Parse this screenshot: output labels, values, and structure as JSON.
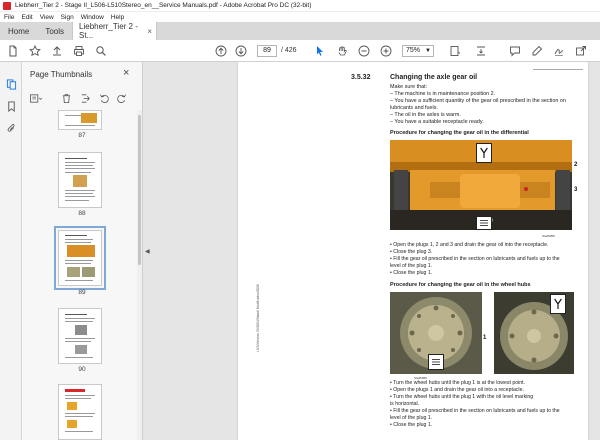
{
  "window": {
    "title": "Liebherr_Tier 2 - Stage II_L506-L510Stereo_en__Service Manuals.pdf - Adobe Acrobat Pro DC (32-bit)"
  },
  "menu": [
    "File",
    "Edit",
    "View",
    "Sign",
    "Window",
    "Help"
  ],
  "tabs": {
    "home": "Home",
    "tools": "Tools",
    "doc": "Liebherr_Tier 2 - St...",
    "doc_close": "×"
  },
  "toolbar": {
    "page_current": "89",
    "page_total": "/ 426",
    "zoom": "75%"
  },
  "panel": {
    "title": "Page Thumbnails",
    "close": "×",
    "thumbnails": [
      {
        "label": "87"
      },
      {
        "label": "88"
      },
      {
        "label": "89"
      },
      {
        "label": "90"
      },
      {
        "label": ""
      }
    ]
  },
  "page": {
    "side_text": "LIVS/Version: 09/2004/Stand/ Modification/2006",
    "section_number": "3.5.32",
    "section_title": "Changing the axle gear oil",
    "make_sure": "Make sure that:",
    "conditions": [
      "–  The machine is in maintenance position 2.",
      "–  You have a sufficient quantity of the gear oil prescribed in the section on",
      "     lubricants and fuels.",
      "–  The oil in the axles is warm.",
      "–  You have a suitable receptacle ready."
    ],
    "diff_heading": "Procedure for changing the gear oil in the differential",
    "diff_callouts": [
      "1",
      "2",
      "3"
    ],
    "diff_caption": "Sta45055",
    "diff_steps": [
      "•  Open the plugs 1, 2 and 3 and drain the gear oil into the receptacle.",
      "•  Close the plug 3.",
      "•  Fill the gear oil prescribed in the section on lubricants and fuels up to the",
      "    level of the plug 1.",
      "•  Close the plug 1."
    ],
    "hub_heading": "Procedure for changing the gear oil in the wheel hubs",
    "hub_callout": "1",
    "hub_caption": "Sta45056",
    "hub_steps": [
      "•  Turn the wheel hubs until the plug 1 is at the lowest point.",
      "•  Open the plugs 1 and drain the gear oil into a receptacle.",
      "•  Turn the wheel hubs until the plug 1 with the oil level marking",
      "    is horizontal.",
      "•  Fill the gear oil prescribed in the section on lubricants and fuels up to the",
      "    level of the plug 1.",
      "•  Close the plug 1."
    ]
  },
  "colors": {
    "accent": "#d8262a",
    "select_blue": "#1473e6",
    "machine_orange": "#e0901c"
  }
}
